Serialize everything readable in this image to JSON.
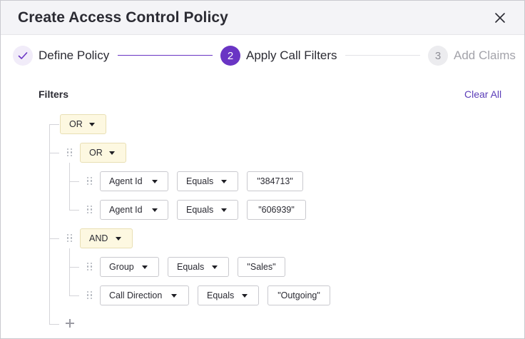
{
  "dialog": {
    "title": "Create Access Control Policy",
    "close_icon": "close-icon"
  },
  "stepper": {
    "steps": [
      {
        "marker": "✓",
        "label": "Define Policy",
        "state": "completed"
      },
      {
        "marker": "2",
        "label": "Apply Call Filters",
        "state": "active"
      },
      {
        "marker": "3",
        "label": "Add Claims",
        "state": "upcoming"
      }
    ]
  },
  "filters": {
    "label": "Filters",
    "clear_all": "Clear All",
    "root_operator": "OR",
    "groups": [
      {
        "operator": "OR",
        "rules": [
          {
            "field": "Agent Id",
            "comparator": "Equals",
            "value": "\"384713\""
          },
          {
            "field": "Agent Id",
            "comparator": "Equals",
            "value": "\"606939\""
          }
        ]
      },
      {
        "operator": "AND",
        "rules": [
          {
            "field": "Group",
            "comparator": "Equals",
            "value": "\"Sales\""
          },
          {
            "field": "Call Direction",
            "comparator": "Equals",
            "value": "\"Outgoing\""
          }
        ]
      }
    ],
    "add_icon": "plus-icon"
  },
  "colors": {
    "accent": "#6a35c4",
    "operator_chip_bg": "#fdf8e1",
    "link": "#5b3db8"
  }
}
